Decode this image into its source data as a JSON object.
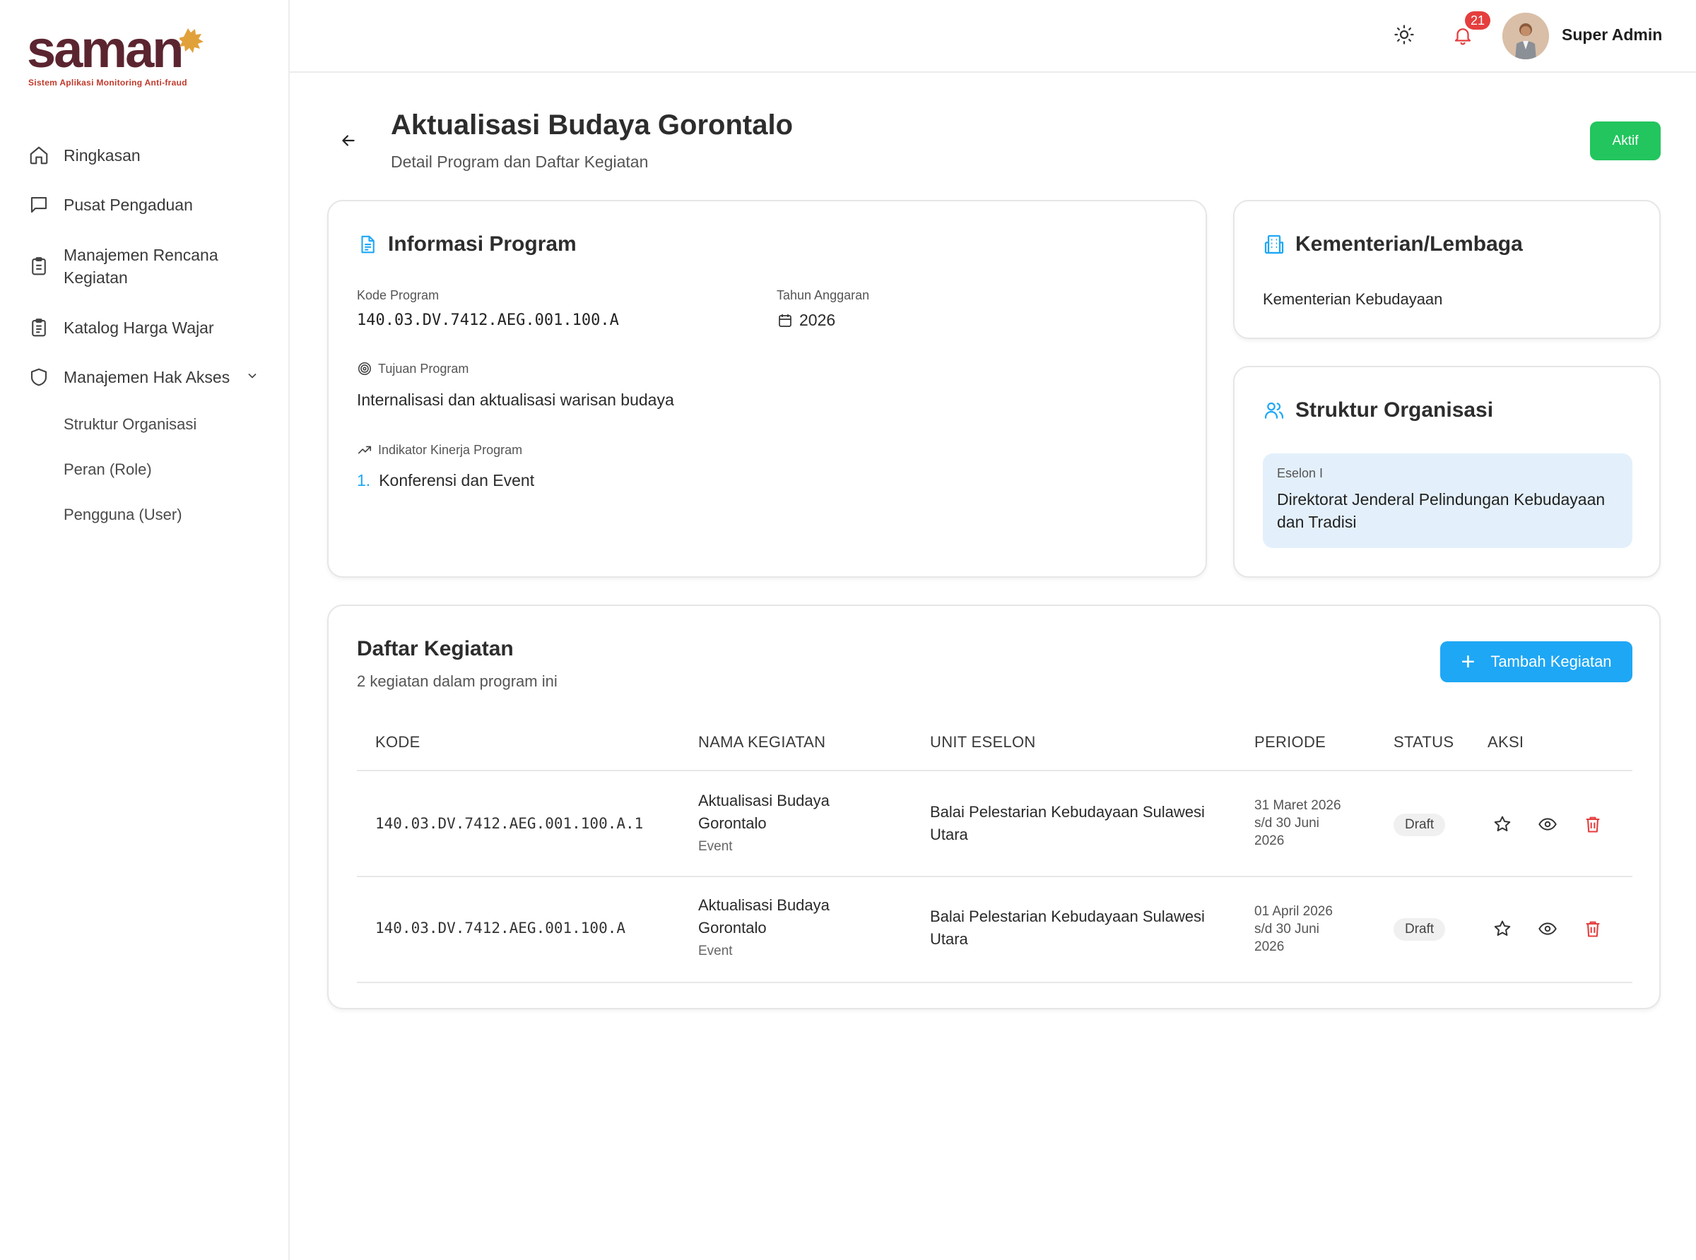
{
  "sidebar": {
    "logo_text": "saman",
    "tagline": "Sistem Aplikasi Monitoring Anti-fraud",
    "items": [
      {
        "label": "Ringkasan",
        "icon": "home-icon"
      },
      {
        "label": "Pusat Pengaduan",
        "icon": "chat-icon"
      },
      {
        "label": "Manajemen Rencana Kegiatan",
        "icon": "clipboard-icon"
      },
      {
        "label": "Katalog Harga Wajar",
        "icon": "clipboard-list-icon"
      },
      {
        "label": "Manajemen Hak Akses",
        "icon": "shield-icon"
      }
    ],
    "sub_items": [
      {
        "label": "Struktur Organisasi"
      },
      {
        "label": "Peran (Role)"
      },
      {
        "label": "Pengguna (User)"
      }
    ]
  },
  "topbar": {
    "notif_count": "21",
    "user_name": "Super Admin"
  },
  "page": {
    "title": "Aktualisasi Budaya Gorontalo",
    "subtitle": "Detail Program dan Daftar Kegiatan",
    "status": "Aktif"
  },
  "info": {
    "title": "Informasi Program",
    "kode_label": "Kode Program",
    "kode_value": "140.03.DV.7412.AEG.001.100.A",
    "tahun_label": "Tahun Anggaran",
    "tahun_value": "2026",
    "tujuan_label": "Tujuan Program",
    "tujuan_value": "Internalisasi dan aktualisasi warisan budaya",
    "indikator_label": "Indikator Kinerja Program",
    "indikator_num": "1.",
    "indikator_value": "Konferensi dan Event"
  },
  "kementerian": {
    "title": "Kementerian/Lembaga",
    "value": "Kementerian Kebudayaan"
  },
  "struktur": {
    "title": "Struktur Organisasi",
    "eselon_label": "Eselon I",
    "eselon_value": "Direktorat Jenderal Pelindungan Kebudayaan dan Tradisi"
  },
  "kegiatan": {
    "title": "Daftar Kegiatan",
    "subtitle": "2 kegiatan dalam program ini",
    "add_label": "Tambah Kegiatan",
    "columns": [
      "KODE",
      "NAMA KEGIATAN",
      "UNIT ESELON",
      "PERIODE",
      "STATUS",
      "AKSI"
    ],
    "rows": [
      {
        "kode": "140.03.DV.7412.AEG.001.100.A.1",
        "nama": "Aktualisasi Budaya Gorontalo",
        "jenis": "Event",
        "unit": "Balai Pelestarian Kebudayaan Sulawesi Utara",
        "periode_start": "31 Maret 2026",
        "periode_sd": "s/d 30 Juni",
        "periode_year": "2026",
        "status": "Draft"
      },
      {
        "kode": "140.03.DV.7412.AEG.001.100.A",
        "nama": "Aktualisasi Budaya Gorontalo",
        "jenis": "Event",
        "unit": "Balai Pelestarian Kebudayaan Sulawesi Utara",
        "periode_start": "01 April 2026",
        "periode_sd": "s/d 30 Juni",
        "periode_year": "2026",
        "status": "Draft"
      }
    ]
  },
  "colors": {
    "brand": "#5b2530",
    "primary": "#1ea7f5",
    "success": "#22c55e",
    "danger": "#e53e3e",
    "eselon_bg": "#e3f0fb"
  }
}
